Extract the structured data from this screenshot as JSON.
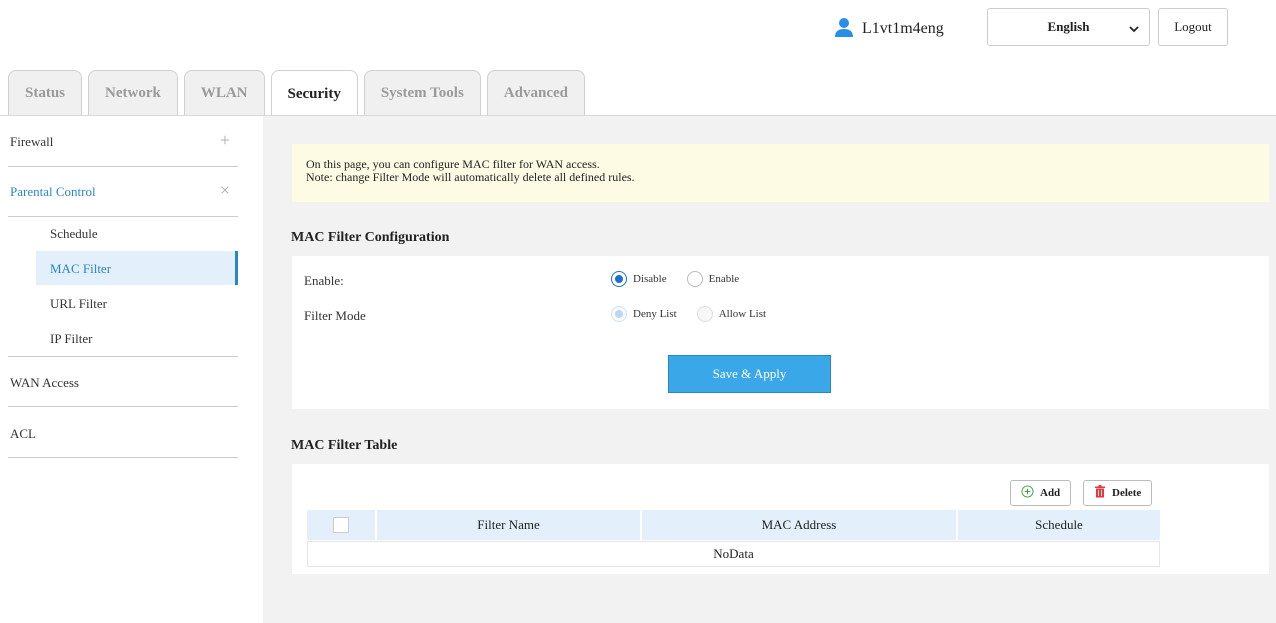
{
  "header": {
    "username": "L1vt1m4eng",
    "language": "English",
    "logout_label": "Logout"
  },
  "tabs": [
    {
      "label": "Status",
      "active": false
    },
    {
      "label": "Network",
      "active": false
    },
    {
      "label": "WLAN",
      "active": false
    },
    {
      "label": "Security",
      "active": true
    },
    {
      "label": "System Tools",
      "active": false
    },
    {
      "label": "Advanced",
      "active": false
    }
  ],
  "sidebar": {
    "firewall": "Firewall",
    "parental_control": "Parental Control",
    "sub_items": [
      "Schedule",
      "MAC Filter",
      "URL Filter",
      "IP Filter"
    ],
    "active_sub": "MAC Filter",
    "wan_access": "WAN Access",
    "acl": "ACL"
  },
  "note": {
    "line1": "On this page, you can configure MAC filter for WAN access.",
    "line2": "Note: change Filter Mode will automatically delete all defined rules."
  },
  "config": {
    "title": "MAC Filter Configuration",
    "enable_label": "Enable:",
    "enable_options": [
      "Disable",
      "Enable"
    ],
    "enable_selected": "Disable",
    "mode_label": "Filter Mode",
    "mode_options": [
      "Deny List",
      "Allow List"
    ],
    "mode_selected": "Deny List",
    "save_label": "Save & Apply"
  },
  "table": {
    "title": "MAC Filter Table",
    "add_label": "Add",
    "delete_label": "Delete",
    "columns": [
      "Filter Name",
      "MAC Address",
      "Schedule"
    ],
    "empty_text": "NoData"
  },
  "colors": {
    "accent": "#2a86c8",
    "button": "#3aa8e8",
    "note_bg": "#fdfbe3",
    "delete_icon": "#e0393e",
    "add_icon": "#3aa34a"
  }
}
